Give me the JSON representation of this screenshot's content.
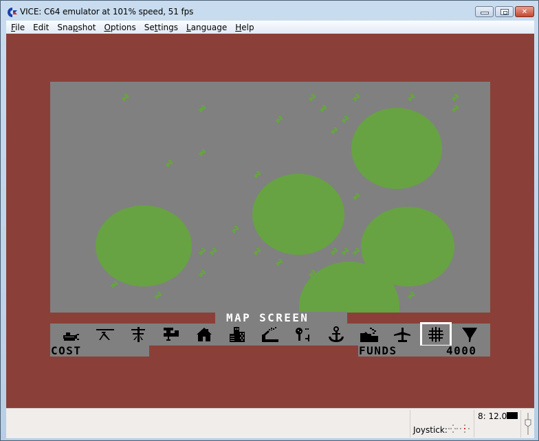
{
  "window": {
    "title": "VICE: C64 emulator at 101% speed, 51 fps",
    "icon": "commodore-logo-icon",
    "controls": [
      "minimize",
      "maximize",
      "close"
    ]
  },
  "menu": {
    "items": [
      {
        "label": "File",
        "accel": "F"
      },
      {
        "label": "Edit",
        "accel": ""
      },
      {
        "label": "Snapshot",
        "accel": "p"
      },
      {
        "label": "Options",
        "accel": "O"
      },
      {
        "label": "Settings",
        "accel": "t"
      },
      {
        "label": "Language",
        "accel": "L"
      },
      {
        "label": "Help",
        "accel": "H"
      }
    ]
  },
  "game": {
    "banner": "MAP SCREEN",
    "cost_label": "COST",
    "funds_label": "FUNDS",
    "funds_value": "4000",
    "colors": {
      "border": "#8a4038",
      "map": "#808080",
      "forest": "#67a342",
      "text": "#000000",
      "banner_text": "#ffffff",
      "selection": "#ffffff"
    },
    "tools": [
      {
        "name": "bulldozer-icon",
        "selected": false
      },
      {
        "name": "road-icon",
        "selected": false
      },
      {
        "name": "power-line-icon",
        "selected": false
      },
      {
        "name": "water-pipe-icon",
        "selected": false
      },
      {
        "name": "house-icon",
        "selected": false
      },
      {
        "name": "office-building-icon",
        "selected": false
      },
      {
        "name": "factory-icon",
        "selected": false
      },
      {
        "name": "park-icon",
        "selected": false
      },
      {
        "name": "port-anchor-icon",
        "selected": false
      },
      {
        "name": "industry-icon",
        "selected": false
      },
      {
        "name": "airport-icon",
        "selected": false
      },
      {
        "name": "map-grid-icon",
        "selected": true
      },
      {
        "name": "disaster-tornado-icon",
        "selected": false
      }
    ]
  },
  "status": {
    "drive": "8: 12.0",
    "joystick_label": "Joystick:"
  }
}
